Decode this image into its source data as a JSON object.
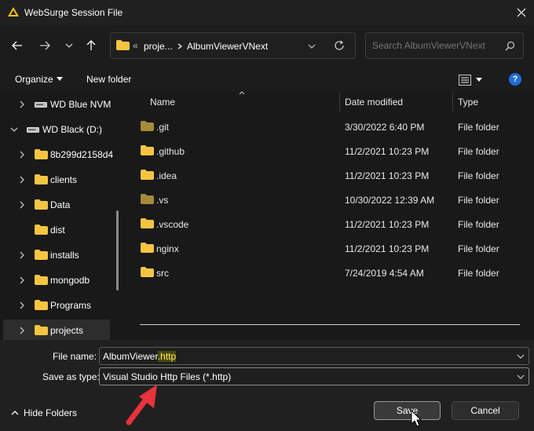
{
  "window": {
    "title": "WebSurge Session File"
  },
  "address": {
    "overflow": "«",
    "crumbs": [
      "proje...",
      "AlbumViewerVNext"
    ]
  },
  "search": {
    "placeholder": "Search AlbumViewerVNext"
  },
  "toolbar": {
    "organize": "Organize",
    "new_folder": "New folder",
    "help": "?"
  },
  "nav": {
    "items": [
      {
        "label": "WD Blue NVM",
        "icon": "drive-icon",
        "level": 1,
        "expanded": false
      },
      {
        "label": "WD Black (D:)",
        "icon": "drive-icon",
        "level": 0,
        "expanded": true
      },
      {
        "label": "8b299d2158d4",
        "icon": "folder-icon",
        "level": 1,
        "expanded": false
      },
      {
        "label": "clients",
        "icon": "folder-icon",
        "level": 1,
        "expanded": false
      },
      {
        "label": "Data",
        "icon": "folder-icon",
        "level": 1,
        "expanded": false
      },
      {
        "label": "dist",
        "icon": "folder-icon",
        "level": 1,
        "expanded": null
      },
      {
        "label": "installs",
        "icon": "folder-icon",
        "level": 1,
        "expanded": false
      },
      {
        "label": "mongodb",
        "icon": "folder-icon",
        "level": 1,
        "expanded": false
      },
      {
        "label": "Programs",
        "icon": "folder-icon",
        "level": 1,
        "expanded": false
      },
      {
        "label": "projects",
        "icon": "folder-icon",
        "level": 1,
        "expanded": false,
        "selected": true
      }
    ]
  },
  "files": {
    "columns": [
      "Name",
      "Date modified",
      "Type"
    ],
    "rows": [
      {
        "name": ".git",
        "date": "3/30/2022 6:40 PM",
        "type": "File folder",
        "hidden": true
      },
      {
        "name": ".github",
        "date": "11/2/2021 10:23 PM",
        "type": "File folder",
        "hidden": false
      },
      {
        "name": ".idea",
        "date": "11/2/2021 10:23 PM",
        "type": "File folder",
        "hidden": false
      },
      {
        "name": ".vs",
        "date": "10/30/2022 12:39 AM",
        "type": "File folder",
        "hidden": true
      },
      {
        "name": ".vscode",
        "date": "11/2/2021 10:23 PM",
        "type": "File folder",
        "hidden": false
      },
      {
        "name": "nginx",
        "date": "11/2/2021 10:23 PM",
        "type": "File folder",
        "hidden": false
      },
      {
        "name": "src",
        "date": "7/24/2019 4:54 AM",
        "type": "File folder",
        "hidden": false
      }
    ]
  },
  "form": {
    "filename_label": "File name:",
    "filename_base": "AlbumViewer",
    "filename_ext": ".http",
    "savetype_label": "Save as type:",
    "savetype_value": "Visual Studio Http Files (*.http)"
  },
  "footer": {
    "hide_folders": "Hide Folders",
    "save": "Save",
    "cancel": "Cancel"
  },
  "colors": {
    "folder": "#f5c542",
    "folder_hidden": "#a58a3a",
    "accent": "#1e6fd9",
    "arrow": "#e8323c",
    "highlight": "#ffe65c"
  }
}
